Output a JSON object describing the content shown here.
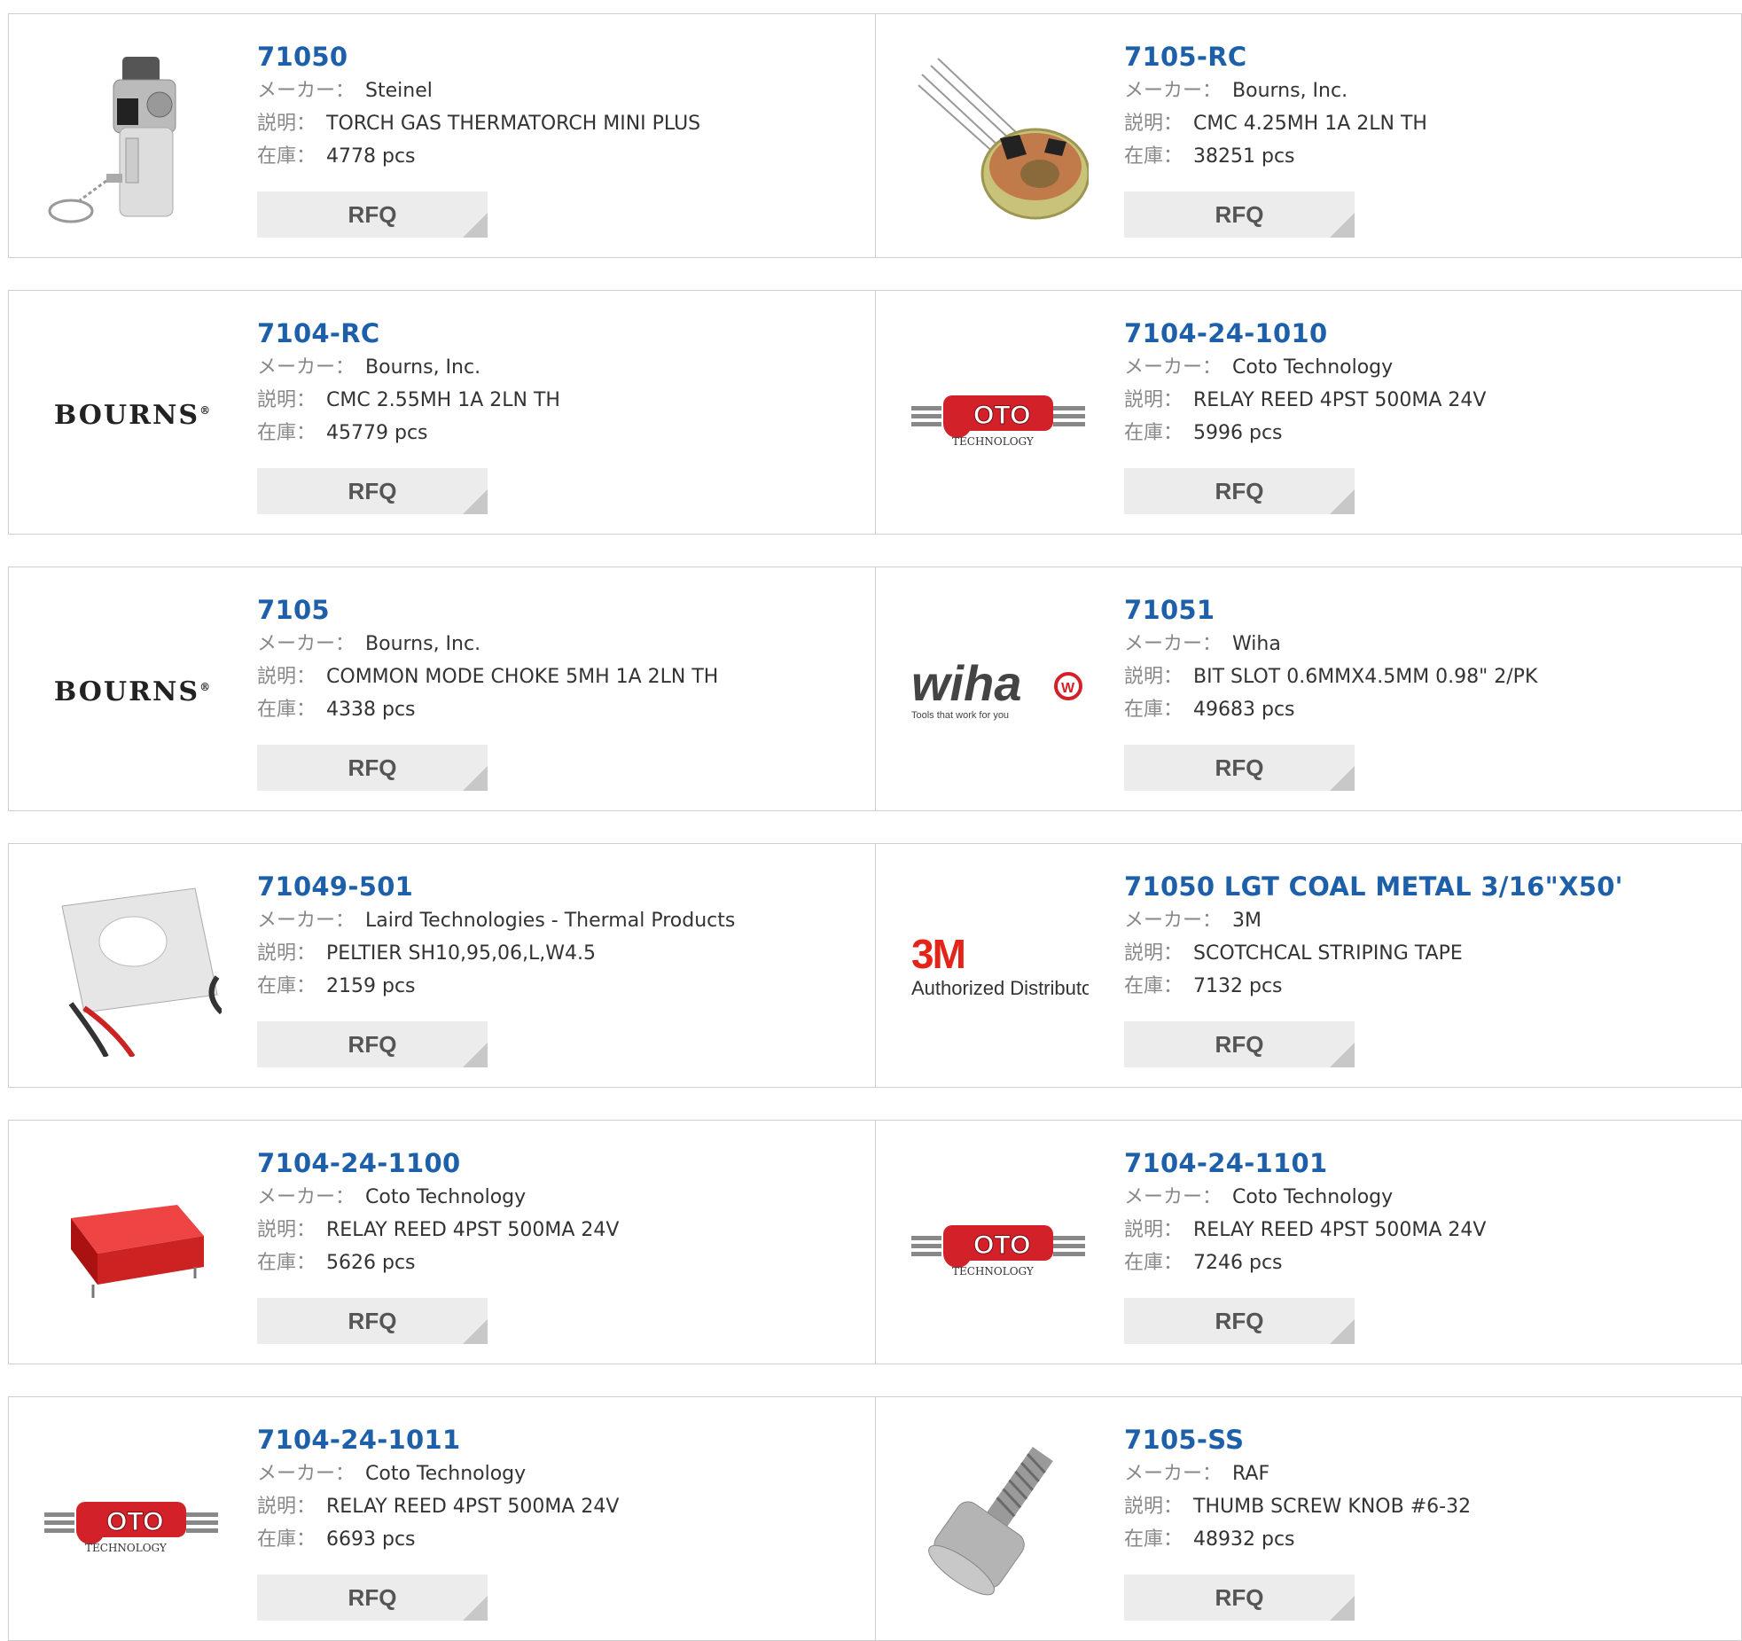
{
  "labels": {
    "manufacturer": "メーカー：",
    "description": "説明：",
    "stock": "在庫："
  },
  "rfq_label": "RFQ",
  "products": [
    {
      "part": "71050",
      "manufacturer": "Steinel",
      "description": "TORCH GAS THERMATORCH MINI PLUS",
      "stock": "4778 pcs",
      "image": "torch-lighter"
    },
    {
      "part": "7105-RC",
      "manufacturer": "Bourns, Inc.",
      "description": "CMC 4.25MH 1A 2LN TH",
      "stock": "38251 pcs",
      "image": "toroid-choke"
    },
    {
      "part": "7104-RC",
      "manufacturer": "Bourns, Inc.",
      "description": "CMC 2.55MH 1A 2LN TH",
      "stock": "45779 pcs",
      "image": "bourns-logo"
    },
    {
      "part": "7104-24-1010",
      "manufacturer": "Coto Technology",
      "description": "RELAY REED 4PST 500MA 24V",
      "stock": "5996 pcs",
      "image": "coto-logo"
    },
    {
      "part": "7105",
      "manufacturer": "Bourns, Inc.",
      "description": "COMMON MODE CHOKE 5MH 1A 2LN TH",
      "stock": "4338 pcs",
      "image": "bourns-logo"
    },
    {
      "part": "71051",
      "manufacturer": "Wiha",
      "description": "BIT SLOT 0.6MMX4.5MM 0.98\" 2/PK",
      "stock": "49683 pcs",
      "image": "wiha-logo"
    },
    {
      "part": "71049-501",
      "manufacturer": "Laird Technologies - Thermal Products",
      "description": "PELTIER SH10,95,06,L,W4.5",
      "stock": "2159 pcs",
      "image": "peltier-module"
    },
    {
      "part": "71050 LGT COAL METAL 3/16\"X50'",
      "manufacturer": "3M",
      "description": "SCOTCHCAL STRIPING TAPE",
      "stock": "7132 pcs",
      "image": "3m-logo"
    },
    {
      "part": "7104-24-1100",
      "manufacturer": "Coto Technology",
      "description": "RELAY REED 4PST 500MA 24V",
      "stock": "5626 pcs",
      "image": "red-relay"
    },
    {
      "part": "7104-24-1101",
      "manufacturer": "Coto Technology",
      "description": "RELAY REED 4PST 500MA 24V",
      "stock": "7246 pcs",
      "image": "coto-logo"
    },
    {
      "part": "7104-24-1011",
      "manufacturer": "Coto Technology",
      "description": "RELAY REED 4PST 500MA 24V",
      "stock": "6693 pcs",
      "image": "coto-logo"
    },
    {
      "part": "7105-SS",
      "manufacturer": "RAF",
      "description": "THUMB SCREW KNOB #6-32",
      "stock": "48932 pcs",
      "image": "thumb-screw"
    }
  ],
  "logo_text": {
    "bourns": "BOURNS",
    "coto": "OTO",
    "coto_sub": "TECHNOLOGY",
    "wiha": "wiha",
    "wiha_sub": "Tools that work for you",
    "m3": "3M",
    "m3_sub": "Authorized Distributor"
  },
  "colors": {
    "link": "#1d5fa8",
    "border": "#cfcfcf",
    "rfq_bg": "#ececec",
    "coto_red": "#d3212a",
    "m3_red": "#e4231b",
    "wiha_red": "#d3212a"
  }
}
